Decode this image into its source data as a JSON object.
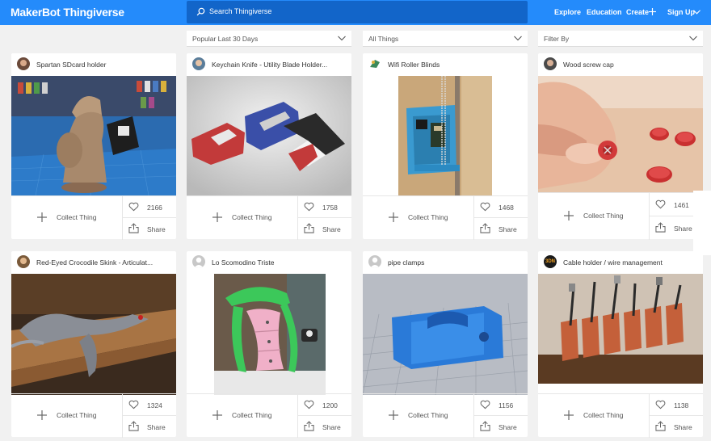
{
  "header": {
    "logo_brand": "MakerBot",
    "logo_product": "Thingiverse",
    "search_placeholder": "Search Thingiverse",
    "nav": {
      "explore": "Explore",
      "education": "Education",
      "create": "Create",
      "signup": "Sign Up"
    }
  },
  "filters": {
    "sort": "Popular Last 30 Days",
    "category": "All Things",
    "filter_by": "Filter By"
  },
  "labels": {
    "collect": "Collect Thing",
    "share": "Share"
  },
  "colors": {
    "header_bg": "#248bfb",
    "search_bg": "#1265c9",
    "page_bg": "#f1f1f1"
  },
  "cards": [
    {
      "title": "Spartan SDcard holder",
      "likes": "2166",
      "avatar": "user-avatar"
    },
    {
      "title": "Keychain Knife - Utility Blade Holder...",
      "likes": "1758",
      "avatar": "user-avatar"
    },
    {
      "title": "Wifi Roller Blinds",
      "likes": "1468",
      "avatar": "user-avatar"
    },
    {
      "title": "Wood screw cap",
      "likes": "1461",
      "avatar": "user-avatar"
    },
    {
      "title": "Red-Eyed Crocodile Skink - Articulat...",
      "likes": "1324",
      "avatar": "user-avatar"
    },
    {
      "title": "Lo Scomodino Triste",
      "likes": "1200",
      "avatar": "default-avatar"
    },
    {
      "title": "pipe clamps",
      "likes": "1156",
      "avatar": "default-avatar"
    },
    {
      "title": "Cable holder / wire management",
      "likes": "1138",
      "avatar": "3dn-avatar",
      "avatar_text": "3DN"
    }
  ]
}
